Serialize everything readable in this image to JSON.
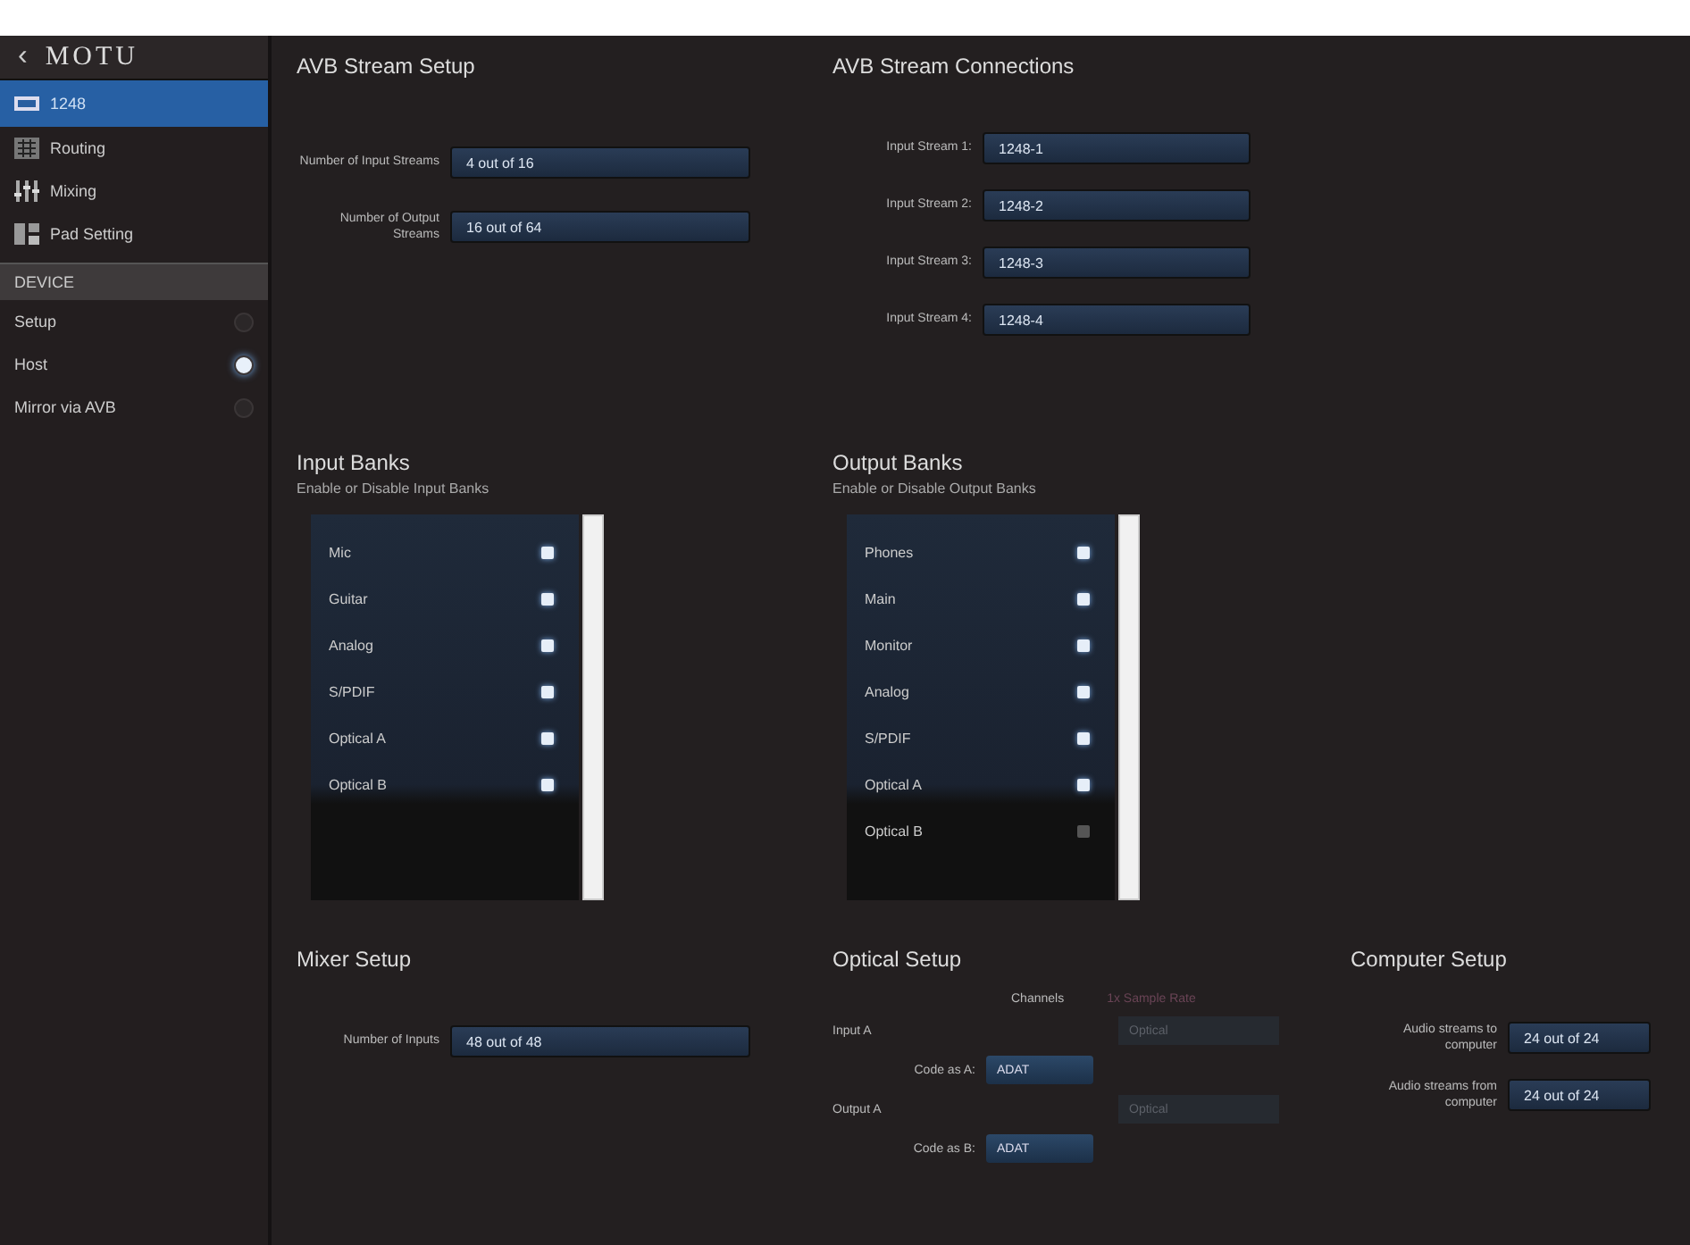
{
  "sidebar": {
    "back": "‹",
    "logo": "MOTU",
    "device": {
      "label": "1248",
      "selected": true
    },
    "nav": [
      {
        "kind": "routing",
        "label": "Routing",
        "selected": false
      },
      {
        "kind": "mixing",
        "label": "Mixing",
        "selected": false
      },
      {
        "kind": "settings",
        "label": "Pad Setting",
        "selected": false
      }
    ],
    "section": "DEVICE",
    "options": [
      {
        "label": "Setup",
        "selected": false
      },
      {
        "label": "Host",
        "selected": true
      },
      {
        "label": "Mirror via AVB",
        "selected": false
      }
    ]
  },
  "avb_stream_setup": {
    "title": "AVB Stream Setup",
    "fields": [
      {
        "label": "Number of Input Streams",
        "value": "4 out of 16"
      },
      {
        "label": "Number of Output Streams",
        "value": "16 out of 64"
      }
    ]
  },
  "avb_stream_connections": {
    "title": "AVB Stream Connections",
    "fields": [
      {
        "label": "Input Stream 1:",
        "value": "1248-1"
      },
      {
        "label": "Input Stream 2:",
        "value": "1248-2"
      },
      {
        "label": "Input Stream 3:",
        "value": "1248-3"
      },
      {
        "label": "Input Stream 4:",
        "value": "1248-4"
      }
    ]
  },
  "input_banks": {
    "title": "Input Banks",
    "subtitle": "Enable or Disable Input Banks",
    "items": [
      {
        "label": "Mic",
        "checked": true
      },
      {
        "label": "Guitar",
        "checked": true
      },
      {
        "label": "Analog",
        "checked": true
      },
      {
        "label": "S/PDIF",
        "checked": true
      },
      {
        "label": "Optical A",
        "checked": true
      },
      {
        "label": "Optical B",
        "checked": true
      }
    ]
  },
  "output_banks": {
    "title": "Output Banks",
    "subtitle": "Enable or Disable Output Banks",
    "items": [
      {
        "label": "Phones",
        "checked": true
      },
      {
        "label": "Main",
        "checked": true
      },
      {
        "label": "Monitor",
        "checked": true
      },
      {
        "label": "Analog",
        "checked": true
      },
      {
        "label": "S/PDIF",
        "checked": true
      },
      {
        "label": "Optical A",
        "checked": true
      },
      {
        "label": "Optical B",
        "checked": false
      }
    ]
  },
  "mixer_setup": {
    "title": "Mixer Setup",
    "fields": [
      {
        "label": "Number of Inputs",
        "value": "48 out of 48"
      }
    ]
  },
  "optical_setup": {
    "title": "Optical Setup",
    "headers": [
      {
        "label": "Channels",
        "disabled": false
      },
      {
        "label": "1x Sample Rate",
        "disabled": true
      }
    ],
    "rows": [
      {
        "label": "Input A",
        "mode": "Optical",
        "mode_disabled": true,
        "code_label": "Code as A:",
        "code": "ADAT"
      },
      {
        "label": "Output A",
        "mode": "Optical",
        "mode_disabled": true,
        "code_label": "Code as B:",
        "code": "ADAT"
      }
    ]
  },
  "computer_setup": {
    "title": "Computer Setup",
    "fields": [
      {
        "label": "Audio streams to computer",
        "value": "24 out of 24"
      },
      {
        "label": "Audio streams from computer",
        "value": "24 out of 24"
      }
    ]
  }
}
